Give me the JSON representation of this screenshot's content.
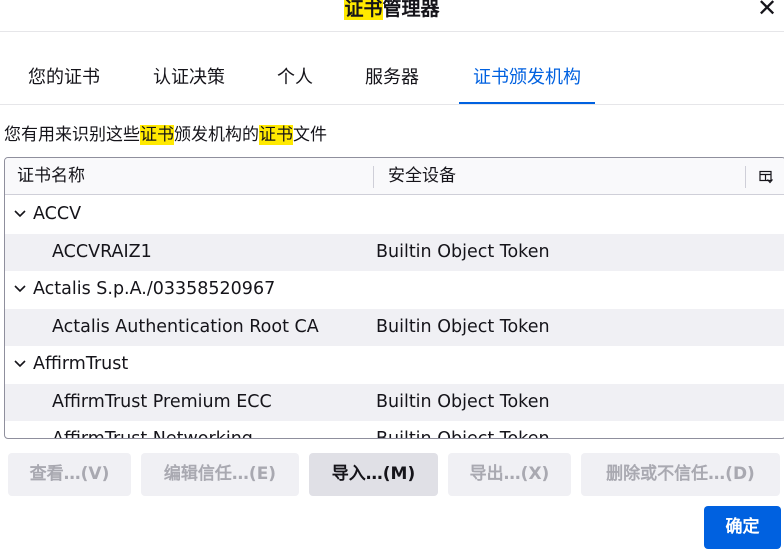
{
  "dialog": {
    "title_pre": "",
    "title_highlight": "证书",
    "title_post": "管理器",
    "close_glyph": "✕"
  },
  "tabs": [
    {
      "label": "您的证书"
    },
    {
      "label": "认证决策"
    },
    {
      "label": "个人"
    },
    {
      "label": "服务器"
    },
    {
      "label": "证书颁发机构"
    }
  ],
  "description": {
    "p1": "您有用来识别这些",
    "h1": "证书",
    "p2": "颁发机构的",
    "h2": "证书",
    "p3": "文件"
  },
  "table": {
    "col1": "证书名称",
    "col2": "安全设备",
    "rows": [
      {
        "name": "ACCV",
        "device": ""
      },
      {
        "name": "ACCVRAIZ1",
        "device": "Builtin Object Token"
      },
      {
        "name": "Actalis S.p.A./03358520967",
        "device": ""
      },
      {
        "name": "Actalis Authentication Root CA",
        "device": "Builtin Object Token"
      },
      {
        "name": "AffirmTrust",
        "device": ""
      },
      {
        "name": "AffirmTrust Premium ECC",
        "device": "Builtin Object Token"
      },
      {
        "name": "AffirmTrust Networking",
        "device": "Builtin Object Token"
      }
    ]
  },
  "buttons": {
    "view": "查看…(V)",
    "edit_trust": "编辑信任…(E)",
    "import": "导入…(M)",
    "export": "导出…(X)",
    "delete": "删除或不信任…(D)",
    "ok": "确定"
  },
  "colors": {
    "accent": "#0061e0",
    "highlight": "#ffe900"
  }
}
